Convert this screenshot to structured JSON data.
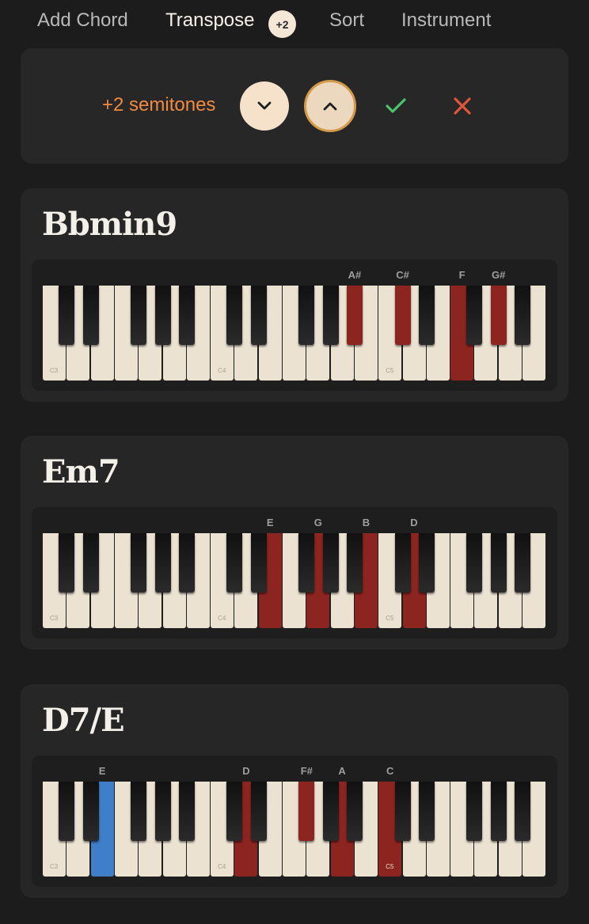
{
  "nav": {
    "add_chord": "Add Chord",
    "transpose": "Transpose",
    "transpose_badge": "+2",
    "sort": "Sort",
    "instrument": "Instrument"
  },
  "transpose_panel": {
    "semitones_label": "+2 semitones",
    "down_icon": "chevron-down-icon",
    "up_icon": "chevron-up-icon",
    "confirm_icon": "check-icon",
    "cancel_icon": "close-icon"
  },
  "colors": {
    "accent_orange": "#f08a40",
    "highlight_red": "#8c2420",
    "highlight_blue": "#3f7ec8",
    "confirm_green": "#4cc36a",
    "cancel_red": "#e0553c"
  },
  "octave_labels": [
    "C3",
    "C4",
    "C5"
  ],
  "chords": [
    {
      "name": "Bbmin9",
      "notes": [
        {
          "label": "A#",
          "key": "A#4"
        },
        {
          "label": "C#",
          "key": "C#5"
        },
        {
          "label": "F",
          "key": "F5"
        },
        {
          "label": "G#",
          "key": "G#5"
        }
      ],
      "bass_key": null
    },
    {
      "name": "Em7",
      "notes": [
        {
          "label": "E",
          "key": "E4"
        },
        {
          "label": "G",
          "key": "G4"
        },
        {
          "label": "B",
          "key": "B4"
        },
        {
          "label": "D",
          "key": "D5"
        }
      ],
      "bass_key": null
    },
    {
      "name": "D7/E",
      "notes": [
        {
          "label": "E",
          "key": "E3"
        },
        {
          "label": "D",
          "key": "D4"
        },
        {
          "label": "F#",
          "key": "F#4"
        },
        {
          "label": "A",
          "key": "A4"
        },
        {
          "label": "C",
          "key": "C5"
        }
      ],
      "bass_key": "E3"
    }
  ]
}
